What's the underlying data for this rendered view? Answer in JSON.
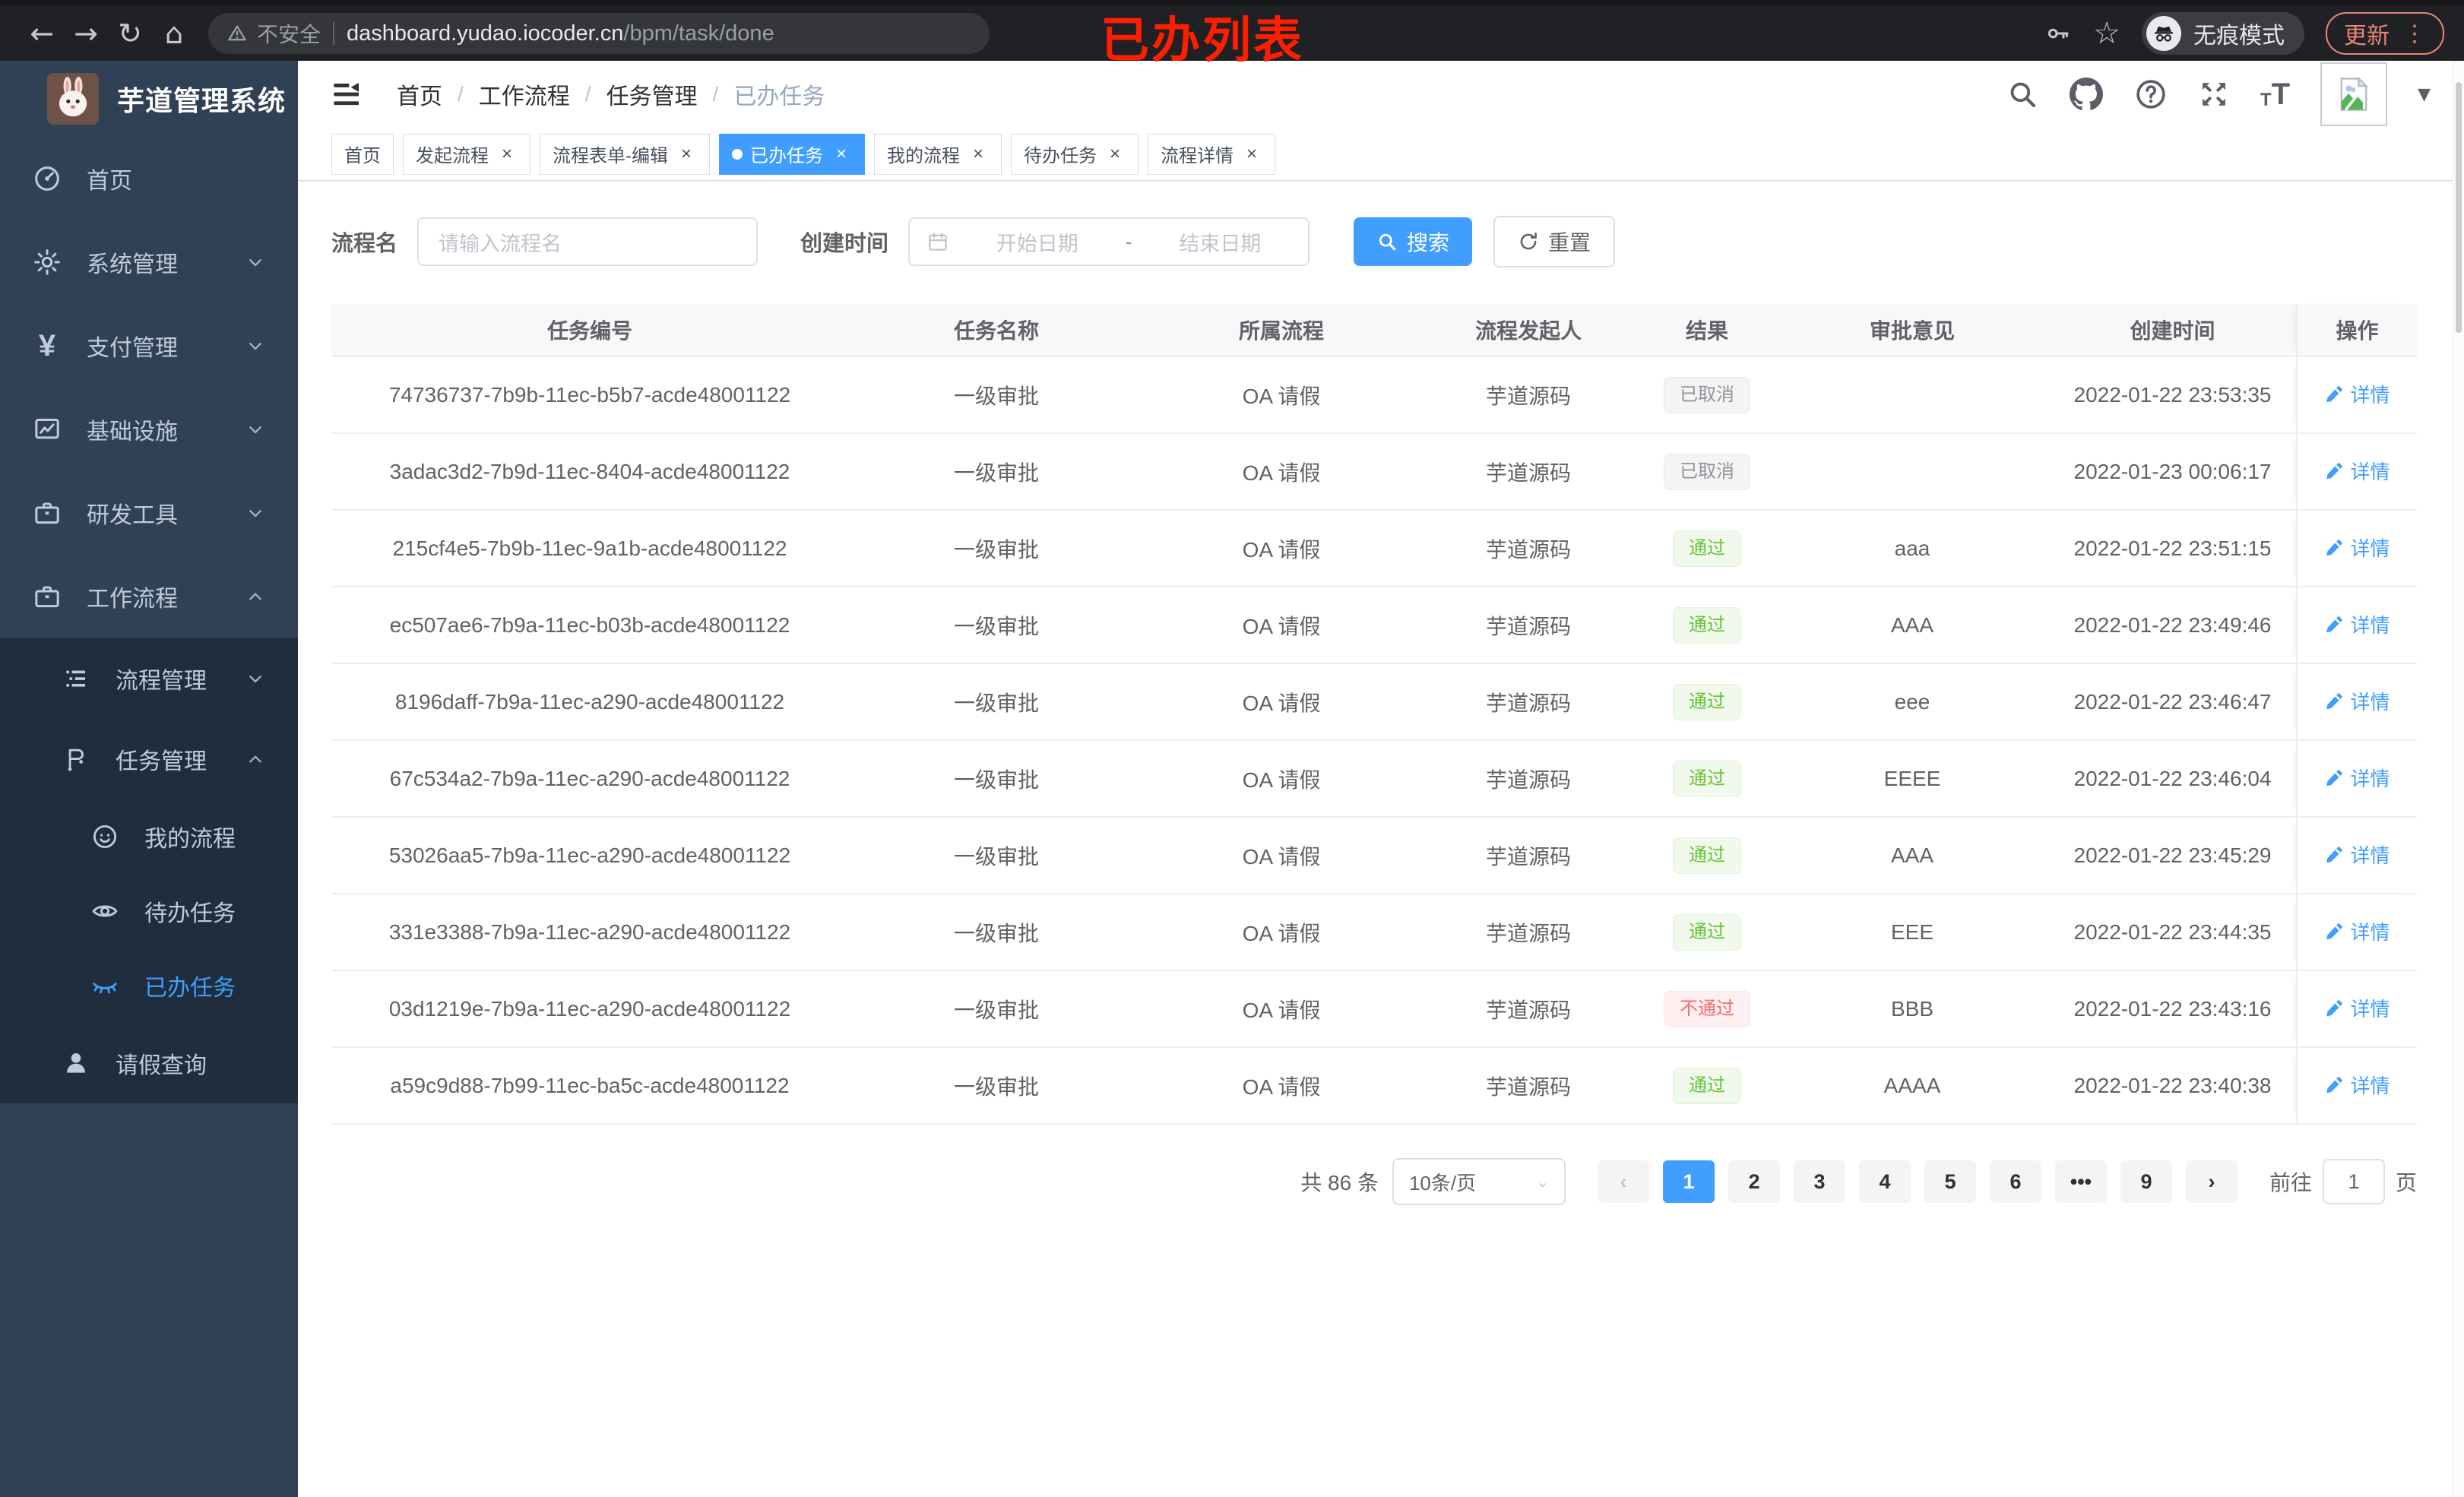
{
  "browser": {
    "back": "←",
    "forward": "→",
    "reload": "↻",
    "home": "⌂",
    "security_label": "不安全",
    "url_host": "dashboard.yudao.iocoder.cn",
    "url_path": "/bpm/task/done",
    "star": "☆",
    "incognito_label": "无痕模式",
    "update_label": "更新",
    "menu_dots": "⋮",
    "caret": "▼"
  },
  "annotation": {
    "text": "已办列表",
    "color": "#ff1e00"
  },
  "colors": {
    "accent": "#409eff",
    "sidebar_bg": "#304156",
    "submenu_bg": "#1f2d3d",
    "success": "#67c23a",
    "danger": "#f56c6c",
    "info": "#909399"
  },
  "sidebar": {
    "title": "芋道管理系统",
    "menu": [
      {
        "label": "首页",
        "icon": "dashboard-icon",
        "chevron": ""
      },
      {
        "label": "系统管理",
        "icon": "gear-icon",
        "chevron": "down"
      },
      {
        "label": "支付管理",
        "icon": "yen-icon",
        "chevron": "down"
      },
      {
        "label": "基础设施",
        "icon": "infra-icon",
        "chevron": "down"
      },
      {
        "label": "研发工具",
        "icon": "devtools-icon",
        "chevron": "down"
      },
      {
        "label": "工作流程",
        "icon": "workflow-icon",
        "chevron": "up"
      }
    ],
    "submenu": [
      {
        "label": "流程管理",
        "icon": "process-icon",
        "chevron": "down",
        "level": 1,
        "active": false
      },
      {
        "label": "任务管理",
        "icon": "task-icon",
        "chevron": "up",
        "level": 1,
        "active": false
      },
      {
        "label": "我的流程",
        "icon": "my-process-icon",
        "chevron": "",
        "level": 2,
        "active": false
      },
      {
        "label": "待办任务",
        "icon": "eye-open-icon",
        "chevron": "",
        "level": 2,
        "active": false
      },
      {
        "label": "已办任务",
        "icon": "eye-closed-icon",
        "chevron": "",
        "level": 2,
        "active": true
      },
      {
        "label": "请假查询",
        "icon": "person-icon",
        "chevron": "",
        "level": 1,
        "active": false
      }
    ]
  },
  "navbar": {
    "breadcrumb": [
      "首页",
      "工作流程",
      "任务管理",
      "已办任务"
    ],
    "separator": "/"
  },
  "tabs": [
    {
      "label": "首页",
      "closable": false,
      "active": false
    },
    {
      "label": "发起流程",
      "closable": true,
      "active": false
    },
    {
      "label": "流程表单-编辑",
      "closable": true,
      "active": false
    },
    {
      "label": "已办任务",
      "closable": true,
      "active": true
    },
    {
      "label": "我的流程",
      "closable": true,
      "active": false
    },
    {
      "label": "待办任务",
      "closable": true,
      "active": false
    },
    {
      "label": "流程详情",
      "closable": true,
      "active": false
    }
  ],
  "filter": {
    "name_label": "流程名",
    "name_placeholder": "请输入流程名",
    "time_label": "创建时间",
    "start_placeholder": "开始日期",
    "range_separator": "-",
    "end_placeholder": "结束日期",
    "search_label": "搜索",
    "reset_label": "重置"
  },
  "table": {
    "columns": [
      "任务编号",
      "任务名称",
      "所属流程",
      "流程发起人",
      "结果",
      "审批意见",
      "创建时间",
      "操作"
    ],
    "detail_label": "详情",
    "rows": [
      {
        "id": "74736737-7b9b-11ec-b5b7-acde48001122",
        "name": "一级审批",
        "process": "OA 请假",
        "starter": "芋道源码",
        "result": "已取消",
        "result_type": "info",
        "opinion": "",
        "time": "2022-01-22 23:53:35"
      },
      {
        "id": "3adac3d2-7b9d-11ec-8404-acde48001122",
        "name": "一级审批",
        "process": "OA 请假",
        "starter": "芋道源码",
        "result": "已取消",
        "result_type": "info",
        "opinion": "",
        "time": "2022-01-23 00:06:17"
      },
      {
        "id": "215cf4e5-7b9b-11ec-9a1b-acde48001122",
        "name": "一级审批",
        "process": "OA 请假",
        "starter": "芋道源码",
        "result": "通过",
        "result_type": "success",
        "opinion": "aaa",
        "time": "2022-01-22 23:51:15"
      },
      {
        "id": "ec507ae6-7b9a-11ec-b03b-acde48001122",
        "name": "一级审批",
        "process": "OA 请假",
        "starter": "芋道源码",
        "result": "通过",
        "result_type": "success",
        "opinion": "AAA",
        "time": "2022-01-22 23:49:46"
      },
      {
        "id": "8196daff-7b9a-11ec-a290-acde48001122",
        "name": "一级审批",
        "process": "OA 请假",
        "starter": "芋道源码",
        "result": "通过",
        "result_type": "success",
        "opinion": "eee",
        "time": "2022-01-22 23:46:47"
      },
      {
        "id": "67c534a2-7b9a-11ec-a290-acde48001122",
        "name": "一级审批",
        "process": "OA 请假",
        "starter": "芋道源码",
        "result": "通过",
        "result_type": "success",
        "opinion": "EEEE",
        "time": "2022-01-22 23:46:04"
      },
      {
        "id": "53026aa5-7b9a-11ec-a290-acde48001122",
        "name": "一级审批",
        "process": "OA 请假",
        "starter": "芋道源码",
        "result": "通过",
        "result_type": "success",
        "opinion": "AAA",
        "time": "2022-01-22 23:45:29"
      },
      {
        "id": "331e3388-7b9a-11ec-a290-acde48001122",
        "name": "一级审批",
        "process": "OA 请假",
        "starter": "芋道源码",
        "result": "通过",
        "result_type": "success",
        "opinion": "EEE",
        "time": "2022-01-22 23:44:35"
      },
      {
        "id": "03d1219e-7b9a-11ec-a290-acde48001122",
        "name": "一级审批",
        "process": "OA 请假",
        "starter": "芋道源码",
        "result": "不通过",
        "result_type": "danger",
        "opinion": "BBB",
        "time": "2022-01-22 23:43:16"
      },
      {
        "id": "a59c9d88-7b99-11ec-ba5c-acde48001122",
        "name": "一级审批",
        "process": "OA 请假",
        "starter": "芋道源码",
        "result": "通过",
        "result_type": "success",
        "opinion": "AAAA",
        "time": "2022-01-22 23:40:38"
      }
    ]
  },
  "pagination": {
    "total_text": "共 86 条",
    "page_size": "10条/页",
    "prev": "‹",
    "next": "›",
    "pages": [
      "1",
      "2",
      "3",
      "4",
      "5",
      "6",
      "•••",
      "9"
    ],
    "active_page": "1",
    "jump_prefix": "前往",
    "jump_value": "1",
    "jump_suffix": "页"
  }
}
